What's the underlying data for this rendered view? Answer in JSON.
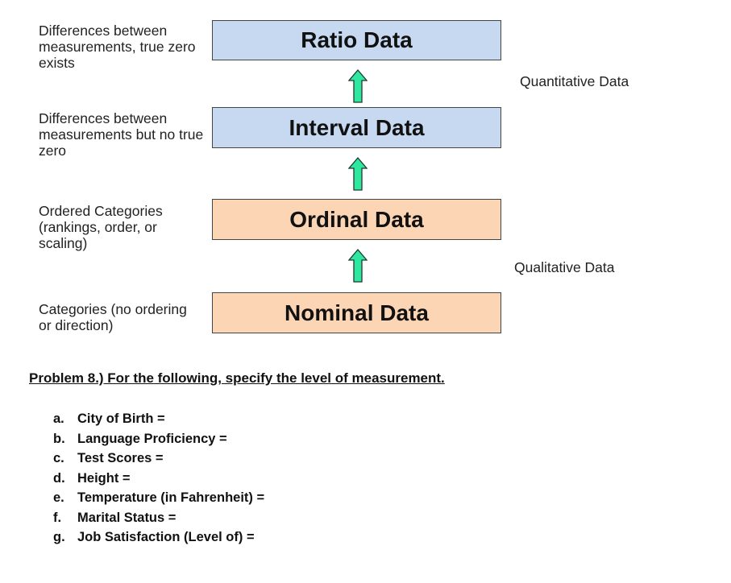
{
  "levels": [
    {
      "name": "Ratio Data",
      "description": "Differences between measurements, true zero exists",
      "color": "#c6d9f1"
    },
    {
      "name": "Interval Data",
      "description": "Differences between measurements but no true zero",
      "color": "#c6d9f1"
    },
    {
      "name": "Ordinal Data",
      "description": "Ordered Categories (rankings, order, or scaling)",
      "color": "#fcd5b5"
    },
    {
      "name": "Nominal Data",
      "description": "Categories (no ordering or direction)",
      "color": "#fcd5b5"
    }
  ],
  "groups": {
    "quantitative": "Quantitative Data",
    "qualitative": "Qualitative Data"
  },
  "arrow_color": "#2ee8a0",
  "problem": {
    "heading": "Problem 8.) For the following, specify the level of measurement.",
    "items": [
      {
        "letter": "a.",
        "text": "City of Birth ="
      },
      {
        "letter": "b.",
        "text": "Language Proficiency ="
      },
      {
        "letter": "c.",
        "text": "Test Scores ="
      },
      {
        "letter": "d.",
        "text": "Height ="
      },
      {
        "letter": "e.",
        "text": "Temperature (in Fahrenheit) ="
      },
      {
        "letter": "f.",
        "text": "Marital Status ="
      },
      {
        "letter": "g.",
        "text": "Job Satisfaction (Level of) ="
      }
    ]
  }
}
